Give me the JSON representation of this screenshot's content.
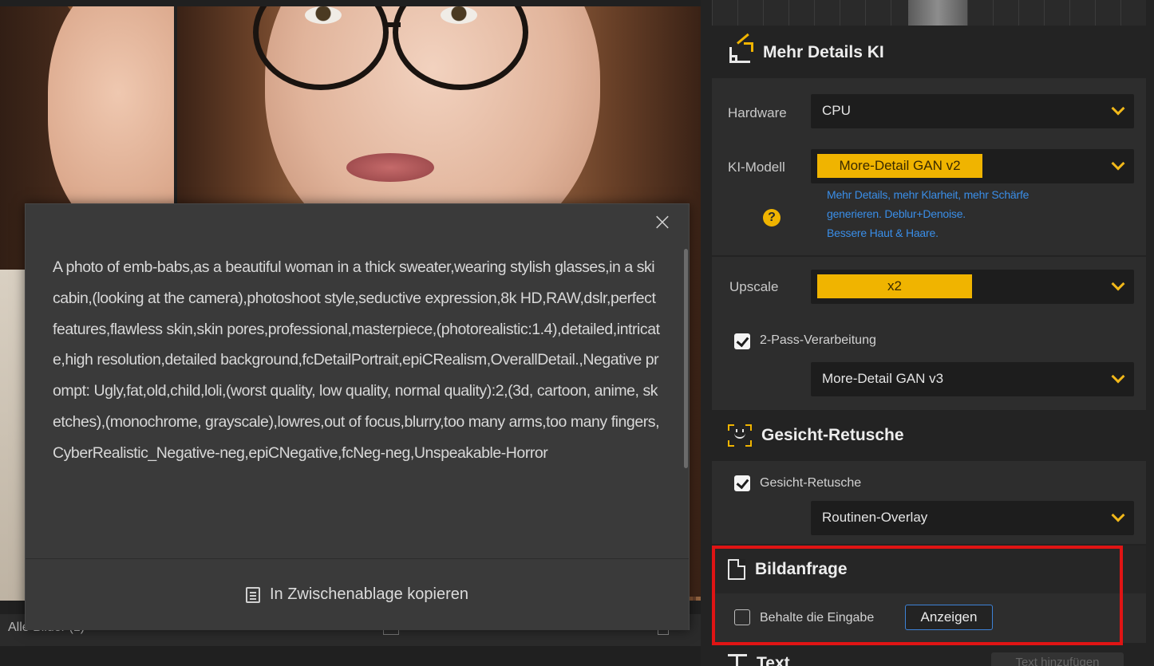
{
  "popup": {
    "prompt_text": "A photo of emb-babs,as a beautiful woman in a thick sweater,wearing stylish glasses,in a ski cabin,(looking at the camera),photoshoot style,seductive expression,8k HD,RAW,dslr,perfect features,flawless skin,skin pores,professional,masterpiece,(photorealistic:1.4),detailed,intricate,high resolution,detailed background,fcDetailPortrait,epiCRealism,OverallDetail.,Negative prompt: Ugly,fat,old,child,loli,(worst quality, low quality, normal quality):2,(3d, cartoon, anime, sketches),(monochrome, grayscale),lowres,out of focus,blurry,too many arms,too many fingers,CyberRealistic_Negative-neg,epiCNegative,fcNeg-neg,Unspeakable-Horror",
    "close_glyph": "×",
    "copy_button_label": "In Zwischenablage kopieren"
  },
  "bottom_bar": {
    "text": "Alle Bilder (1) · · · ·"
  },
  "panel": {
    "mehr_details": {
      "title": "Mehr Details KI",
      "hardware_label": "Hardware",
      "hardware_value": "CPU",
      "model_label": "KI-Modell",
      "model_value": "More-Detail GAN v2",
      "help_glyph": "?",
      "description_lines": [
        "Mehr Details, mehr Klarheit, mehr Schärfe",
        "generieren. Deblur+Denoise.",
        "Bessere Haut & Haare."
      ],
      "upscale_label": "Upscale",
      "upscale_value": "x2",
      "two_pass_label": "2-Pass-Verarbeitung",
      "two_pass_checked": true,
      "two_pass_model": "More-Detail GAN  v3"
    },
    "gesicht": {
      "title": "Gesicht-Retusche",
      "checkbox_label": "Gesicht-Retusche",
      "checked": true,
      "mode_value": "Routinen-Overlay"
    },
    "bildanfrage": {
      "title": "Bildanfrage",
      "keep_input_label": "Behalte die Eingabe",
      "keep_input_checked": false,
      "show_button": "Anzeigen"
    },
    "text_section": {
      "title": "Text",
      "add_text_button": "Text hinzufügen"
    }
  },
  "colors": {
    "accent": "#f0b400",
    "link_blue": "#3a8ee8",
    "highlight_red": "#e01414",
    "button_border": "#3d82d6"
  },
  "icons": {
    "mehr_details": "enhance-detail-icon",
    "gesicht": "face-scan-icon",
    "bildanfrage": "document-icon",
    "text": "text-icon",
    "copy": "clipboard-icon"
  }
}
